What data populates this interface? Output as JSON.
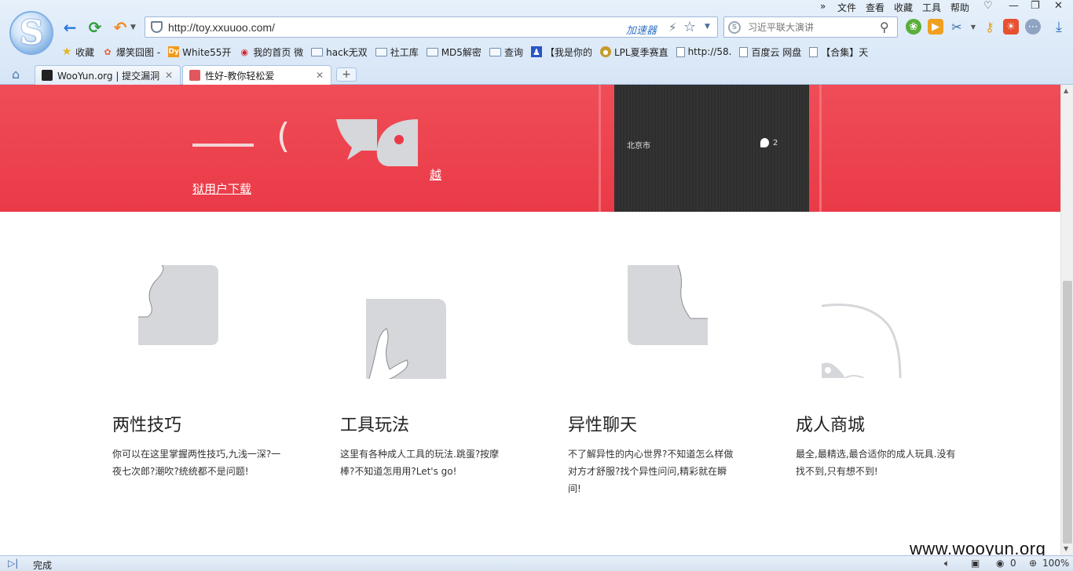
{
  "browser": {
    "url": "http://toy.xxuuoo.com/",
    "accelerator_label": "加速器",
    "search_placeholder": "习近平联大演讲",
    "menu": [
      "文件",
      "查看",
      "收藏",
      "工具",
      "帮助"
    ],
    "more_label": "»",
    "bookmarks": [
      {
        "label": "收藏",
        "icon": "star-icon"
      },
      {
        "label": "爆笑囧图 -",
        "icon": "flower-icon"
      },
      {
        "label": "White55开",
        "icon": "dy-icon"
      },
      {
        "label": "我的首页 微",
        "icon": "weibo-icon"
      },
      {
        "label": "hack无双",
        "icon": "folder-icon"
      },
      {
        "label": "社工库",
        "icon": "folder-icon"
      },
      {
        "label": "MD5解密",
        "icon": "folder-icon"
      },
      {
        "label": "查询",
        "icon": "folder-icon"
      },
      {
        "label": "【我是你的",
        "icon": "paw-icon"
      },
      {
        "label": "LPL夏季赛直",
        "icon": "lpl-icon"
      },
      {
        "label": "http://58.",
        "icon": "page-icon"
      },
      {
        "label": "百度云 网盘",
        "icon": "page-icon"
      },
      {
        "label": "【合集】天",
        "icon": "page-icon"
      }
    ],
    "tabs": [
      {
        "label": "WooYun.org | 提交漏洞",
        "active": false
      },
      {
        "label": "性好-教你轻松爱",
        "active": true
      }
    ],
    "new_tab_label": "+",
    "status_text": "完成",
    "zoom": "100%",
    "counter": "0"
  },
  "page": {
    "download_link": "狱用户下载",
    "yue_link": "越",
    "phone_city": "北京市",
    "phone_count": "2",
    "features": [
      {
        "title": "两性技巧",
        "desc": "你可以在这里掌握两性技巧,九浅一深?一夜七次郎?潮吹?统统都不是问题!"
      },
      {
        "title": "工具玩法",
        "desc": "这里有各种成人工具的玩法.跳蛋?按摩棒?不知道怎用用?Let's go!"
      },
      {
        "title": "异性聊天",
        "desc": "不了解异性的内心世界?不知道怎么样做对方才舒服?找个异性问问,精彩就在瞬间!"
      },
      {
        "title": "成人商城",
        "desc": "最全,最精选,最合适你的成人玩具.没有找不到,只有想不到!"
      }
    ]
  },
  "watermark": "www.wooyun.org",
  "colors": {
    "banner": "#ea3a48",
    "chrome": "#dbe8f7",
    "icon_gray": "#d5d7da"
  }
}
